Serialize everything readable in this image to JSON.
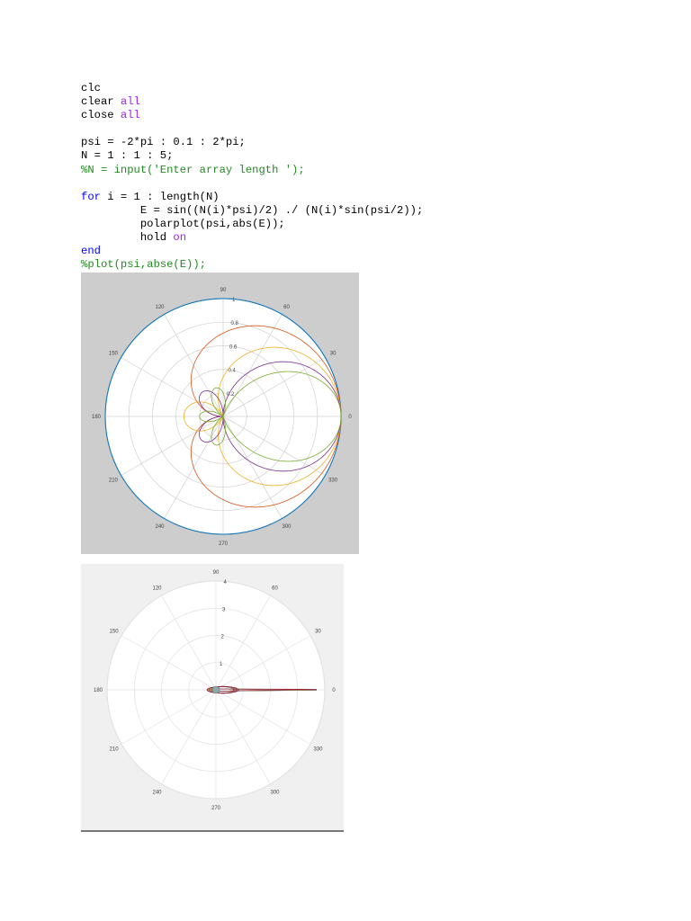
{
  "code": [
    {
      "parts": [
        {
          "t": "clc",
          "c": ""
        }
      ]
    },
    {
      "parts": [
        {
          "t": "clear ",
          "c": ""
        },
        {
          "t": "all",
          "c": "str"
        }
      ]
    },
    {
      "parts": [
        {
          "t": "close ",
          "c": ""
        },
        {
          "t": "all",
          "c": "str"
        }
      ]
    },
    {
      "parts": []
    },
    {
      "parts": [
        {
          "t": "psi = -2*pi : 0.1 : 2*pi;",
          "c": ""
        }
      ]
    },
    {
      "parts": [
        {
          "t": "N = 1 : 1 : 5;",
          "c": ""
        }
      ]
    },
    {
      "parts": [
        {
          "t": "%N = input('Enter array length ');",
          "c": "cm"
        }
      ]
    },
    {
      "parts": []
    },
    {
      "parts": [
        {
          "t": "for",
          "c": "kw"
        },
        {
          "t": " i = 1 : length(N)",
          "c": ""
        }
      ]
    },
    {
      "parts": [
        {
          "t": "         E = sin((N(i)*psi)/2) ./ (N(i)*sin(psi/2));",
          "c": ""
        }
      ]
    },
    {
      "parts": [
        {
          "t": "         polarplot(psi,abs(E));",
          "c": ""
        }
      ]
    },
    {
      "parts": [
        {
          "t": "         hold ",
          "c": ""
        },
        {
          "t": "on",
          "c": "str"
        }
      ]
    },
    {
      "parts": [
        {
          "t": "end",
          "c": "kw"
        }
      ]
    },
    {
      "parts": [
        {
          "t": "%plot(psi,abse(E));",
          "c": "cm"
        }
      ]
    }
  ],
  "chart_data": [
    {
      "type": "line",
      "subtype": "polar",
      "title": "",
      "angle_ticks": [
        "0",
        "30",
        "60",
        "90",
        "120",
        "150",
        "180",
        "210",
        "240",
        "270",
        "300",
        "330"
      ],
      "r_ticks": [
        "0.2",
        "0.4",
        "0.6",
        "0.8",
        "1"
      ],
      "rlim": [
        0,
        1
      ],
      "series_N": [
        1,
        2,
        3,
        4,
        5
      ],
      "colors": [
        "#0072BD",
        "#D95319",
        "#EDB120",
        "#7E2F8E",
        "#77AC30"
      ],
      "grid": true
    },
    {
      "type": "line",
      "subtype": "polar",
      "title": "",
      "angle_ticks": [
        "0",
        "30",
        "60",
        "90",
        "120",
        "150",
        "180",
        "210",
        "240",
        "270",
        "300",
        "330"
      ],
      "r_ticks": [
        "1",
        "2",
        "3",
        "4"
      ],
      "rlim": [
        0,
        4
      ],
      "peak_r": 3.7,
      "colors": [
        "#0072BD",
        "#D95319",
        "#EDB120",
        "#7E2F8E",
        "#77AC30",
        "#4DBEEE",
        "#A2142F"
      ],
      "grid": true
    }
  ]
}
